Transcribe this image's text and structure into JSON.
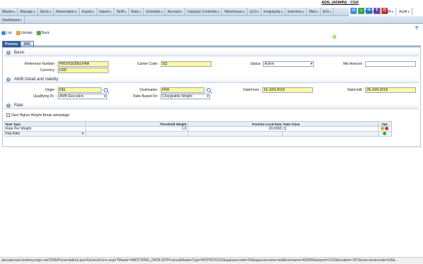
{
  "user": {
    "display": "ADIL (ADMIN) · CGK"
  },
  "menu": {
    "items": [
      "Master",
      "Manage",
      "Stock",
      "Reservation",
      "Export",
      "Import",
      "Tariff",
      "Rate",
      "Schedule",
      "Account",
      "Capacity Controller",
      "Warehouse",
      "ULD",
      "Irregularity",
      "Inventory",
      "Mail",
      "EDI",
      "Report",
      "CRA",
      "Audit"
    ],
    "row2": [
      "Dashboard"
    ]
  },
  "toolbar_icons": [
    {
      "name": "email-icon",
      "glyph": "✉",
      "color": "#3c8dde"
    },
    {
      "name": "home-icon",
      "glyph": "⌂",
      "color": "#32a852"
    },
    {
      "name": "settings-icon",
      "glyph": "⚙",
      "color": "#3c8dde"
    },
    {
      "name": "translate-icon",
      "glyph": "T",
      "color": "#6b4bb8"
    },
    {
      "name": "power-icon",
      "glyph": "⏻",
      "color": "#d93030"
    }
  ],
  "actions": {
    "list": "List",
    "update": "Update",
    "back": "Back"
  },
  "tabs": [
    "Proviso",
    "SHC"
  ],
  "basic": {
    "title": "Basic",
    "reference_label": "Reference Number :",
    "reference_value": "PROVISODELFRA",
    "currency_label": "Currency :",
    "currency_value": "USD",
    "carrier_label": "Carrier Code :",
    "carrier_value": "SQ",
    "status_label": "Status :",
    "status_value": "Active",
    "min_amount_label": "Min Amount :",
    "min_amount_value": ""
  },
  "awb": {
    "title": "AWB Detail and Validity",
    "origin_label": "Origin :",
    "origin_value": "DEL",
    "qualifying_label": "Qualifying Dt. :",
    "qualifying_value": "AWB Execution",
    "destination_label": "Destination :",
    "destination_value": "FRA",
    "rate_based_label": "Rate Based On :",
    "rate_based_value": "Chargeable Weight",
    "date_from_label": "DateFrom :",
    "date_from_value": "15-JUN-2018",
    "date_until_label": "DateUntil :",
    "date_until_value": "29-JUN-2018"
  },
  "rate": {
    "title": "Rate",
    "checkbox_label": "Give Higher Weight Break advantage",
    "headers": [
      "Rate Type",
      "Threshold Weight",
      "Fraction Local Rate",
      "Rate Class",
      "Opt."
    ],
    "rows": [
      {
        "type": "Rate Per Weight",
        "threshold": "1.0",
        "fraction": "20.0000",
        "rate_class": "Q"
      }
    ],
    "input_row": {
      "type": "Flat Rate",
      "threshold": "",
      "fraction": "",
      "rate_class": ""
    }
  },
  "statusbar": "gecrapreuat.bookmycargo.net/CRA/PresentationLayer/GenericForm.aspx?Master=MATCHING_DATA.INTProviso&MasterType=INTPROVISO&appusercode=53&appusername=adil&rolename=ADMIN&airport=CGK&location=JKT&usercarriercode=GA&..."
}
